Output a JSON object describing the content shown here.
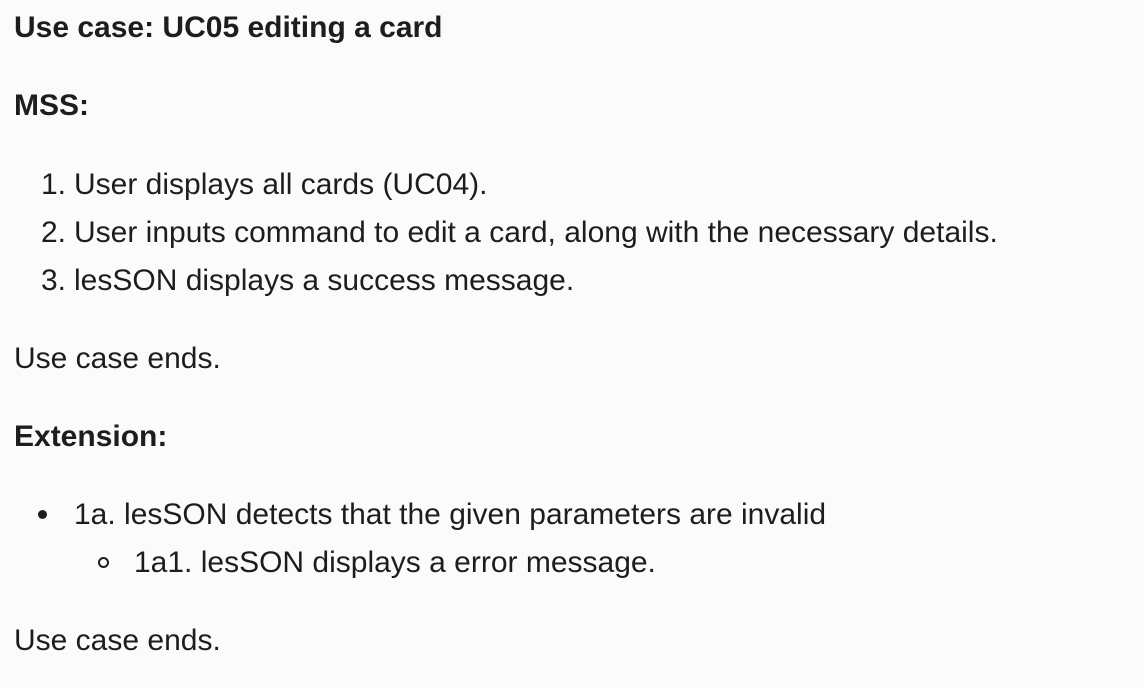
{
  "doc": {
    "title": "Use case: UC05 editing a card",
    "mss_heading": "MSS:",
    "mss_steps": [
      {
        "num": "1.",
        "text": "User displays all cards (UC04)."
      },
      {
        "num": "2.",
        "text": "User inputs command to edit a card, along with the necessary details."
      },
      {
        "num": "3.",
        "text": "lesSON displays a success message."
      }
    ],
    "mss_end": "Use case ends.",
    "extension_heading": "Extension:",
    "extensions": [
      {
        "text": "1a. lesSON detects that the given parameters are invalid",
        "sub": [
          "1a1. lesSON displays a error message."
        ]
      }
    ],
    "extension_end": "Use case ends."
  }
}
